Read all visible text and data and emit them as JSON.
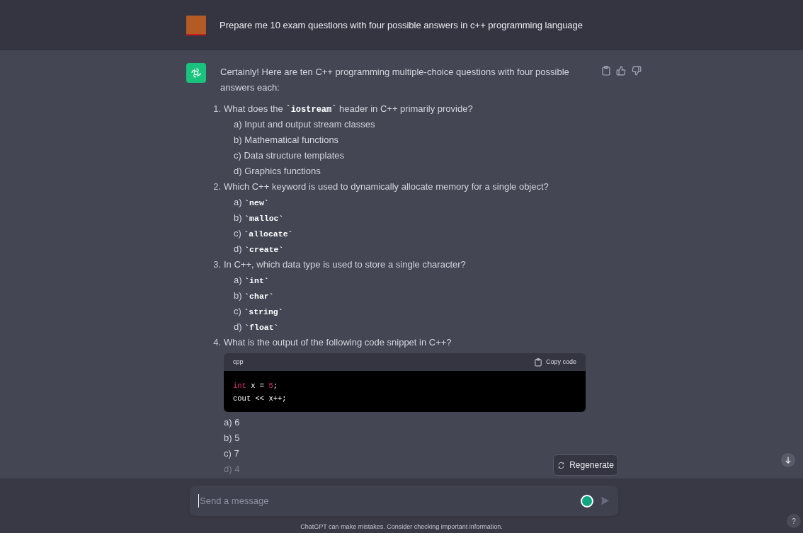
{
  "user_message": {
    "text": "Prepare me 10 exam questions with four possible answers in c++ programming language"
  },
  "assistant_message": {
    "intro": "Certainly! Here are ten C++ programming multiple-choice questions with four possible answers each:",
    "questions": [
      {
        "number": "1.",
        "text": "What does the **`iostream`** header in C++ primarily provide?",
        "options": [
          {
            "text": "a) Input and output stream classes",
            "dimmed": false
          },
          {
            "text": "b) Mathematical functions",
            "dimmed": false
          },
          {
            "text": "c) Data structure templates",
            "dimmed": false
          },
          {
            "text": "d) Graphics functions",
            "dimmed": false
          }
        ]
      },
      {
        "number": "2.",
        "text": "Which C++ keyword is used to dynamically allocate memory for a single object?",
        "options": [
          {
            "text": "a) **`new`**",
            "dimmed": false
          },
          {
            "text": "b) **`malloc`**",
            "dimmed": false
          },
          {
            "text": "c) **`allocate`**",
            "dimmed": false
          },
          {
            "text": "d) **`create`**",
            "dimmed": false
          }
        ]
      },
      {
        "number": "3.",
        "text": "In C++, which data type is used to store a single character?",
        "options": [
          {
            "text": "a) **`int`**",
            "dimmed": false
          },
          {
            "text": "b) **`char`**",
            "dimmed": false
          },
          {
            "text": "c) **`string`**",
            "dimmed": false
          },
          {
            "text": "d) **`float`**",
            "dimmed": false
          }
        ]
      },
      {
        "number": "4.",
        "text": "What is the output of the following code snippet in C++?",
        "code_block": {
          "language": "cpp",
          "copy_label": "Copy code",
          "lines": [
            [
              {
                "kind": "keyword",
                "text": "int"
              },
              {
                "kind": "plain",
                "text": " x = "
              },
              {
                "kind": "number",
                "text": "5"
              },
              {
                "kind": "plain",
                "text": ";"
              }
            ],
            [
              {
                "kind": "plain",
                "text": "cout << x++;"
              }
            ]
          ]
        },
        "options": [
          {
            "text": "a) 6",
            "dimmed": false
          },
          {
            "text": "b) 5",
            "dimmed": false
          },
          {
            "text": "c) 7",
            "dimmed": false
          },
          {
            "text": "d) 4",
            "dimmed": true
          }
        ]
      }
    ]
  },
  "regenerate_button": {
    "label": "Regenerate"
  },
  "composer": {
    "placeholder": "Send a message"
  },
  "footer": "ChatGPT can make mistakes. Consider checking important information.",
  "help_button": {
    "label": "?"
  }
}
